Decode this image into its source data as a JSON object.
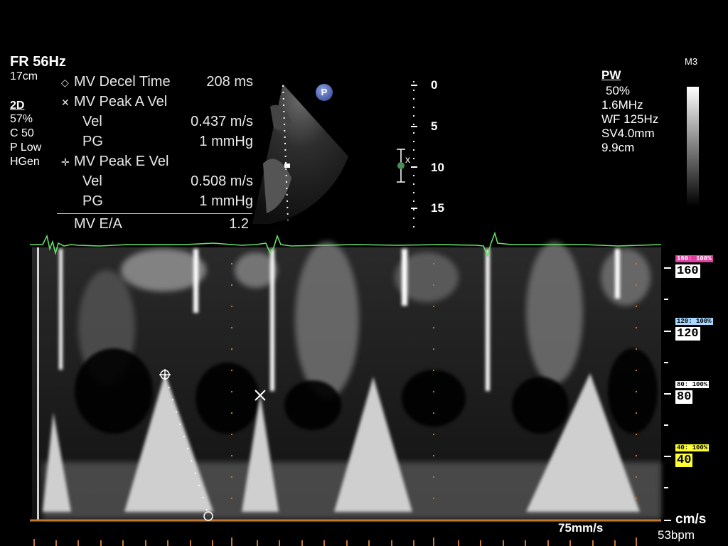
{
  "header": {
    "frame_rate": "FR 56Hz",
    "depth": "17cm"
  },
  "left_params": {
    "mode": "2D",
    "items": [
      "57%",
      "C 50",
      "P Low",
      "HGen"
    ]
  },
  "measurements": {
    "rows": [
      {
        "symbol": "◇",
        "label": "MV Decel Time",
        "value": "208 ms"
      },
      {
        "symbol": "✕",
        "label": "MV Peak A Vel",
        "value": ""
      },
      {
        "symbol": "",
        "label": "Vel",
        "value": "0.437 m/s"
      },
      {
        "symbol": "",
        "label": "PG",
        "value": "1 mmHg"
      },
      {
        "symbol": "✛",
        "label": "MV Peak E Vel",
        "value": ""
      },
      {
        "symbol": "",
        "label": "Vel",
        "value": "0.508 m/s"
      },
      {
        "symbol": "",
        "label": "PG",
        "value": "1 mmHg"
      }
    ],
    "ratio": {
      "label": "MV E/A",
      "value": "1.2"
    }
  },
  "probe_badge": "P",
  "depth_scale": [
    "0",
    "5",
    "10",
    "15"
  ],
  "right_params": {
    "mode": "PW",
    "items": [
      "50%",
      "1.6MHz",
      "WF 125Hz",
      "SV4.0mm",
      "9.9cm"
    ]
  },
  "map_label": "M3",
  "velocity_scale": [
    {
      "tag": "160: 100%",
      "value": "160",
      "color": "#e040a0"
    },
    {
      "tag": "120: 100%",
      "value": "120",
      "color": "#a8d8ff"
    },
    {
      "tag": "80: 100%",
      "value": "80",
      "color": "#ffffff"
    },
    {
      "tag": "40: 100%",
      "value": "40",
      "color": "#ffff33"
    }
  ],
  "unit": "cm/s",
  "sweep_speed": "75mm/s",
  "heart_rate": "53bpm",
  "colors": {
    "ecg": "#66e066",
    "baseline": "#c07830",
    "caliper": "#4a8c5a"
  }
}
